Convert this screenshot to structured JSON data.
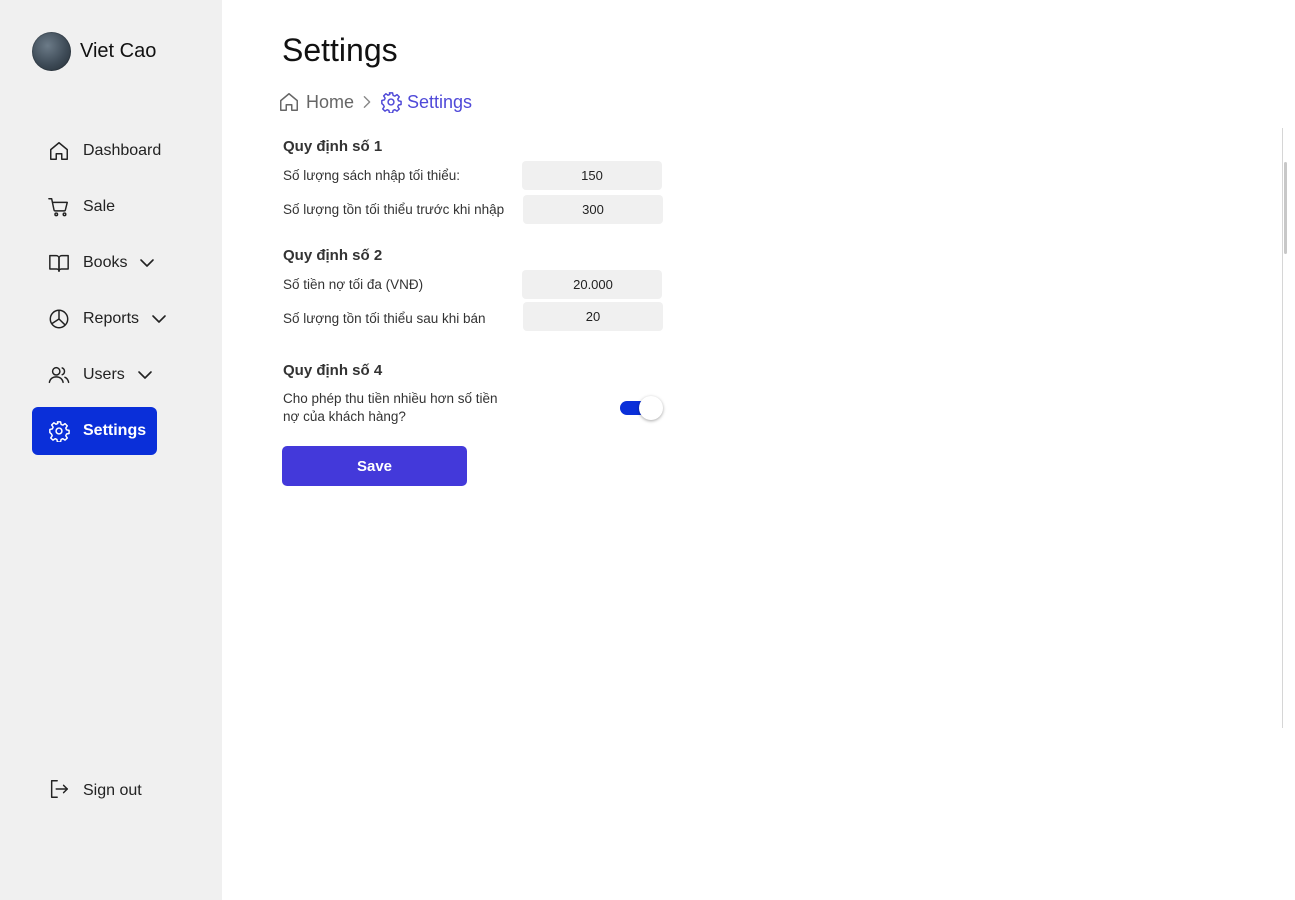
{
  "user": {
    "name": "Viet Cao"
  },
  "nav": {
    "items": [
      {
        "label": "Dashboard",
        "icon": "home-icon"
      },
      {
        "label": "Sale",
        "icon": "cart-icon"
      },
      {
        "label": "Books",
        "icon": "book-icon",
        "expandable": true
      },
      {
        "label": "Reports",
        "icon": "pie-chart-icon",
        "expandable": true
      },
      {
        "label": "Users",
        "icon": "users-icon",
        "expandable": true
      },
      {
        "label": "Settings",
        "icon": "gear-icon",
        "active": true
      }
    ],
    "signout_label": "Sign out"
  },
  "page": {
    "title": "Settings",
    "breadcrumb": {
      "home": "Home",
      "current": "Settings"
    }
  },
  "rules": {
    "rule1": {
      "title": "Quy định số 1",
      "min_import_label": "Số lượng sách nhập tối thiểu:",
      "min_import_value": "150",
      "max_stock_before_label": "Số lượng tồn tối thiểu trước khi nhập",
      "max_stock_before_value": "300"
    },
    "rule2": {
      "title": "Quy định số 2",
      "max_debt_label": "Số tiền nợ tối đa (VNĐ)",
      "max_debt_value": "20.000",
      "min_stock_after_label": "Số lượng tồn tối thiểu sau khi bán",
      "min_stock_after_value": "20"
    },
    "rule4": {
      "title": "Quy định số 4",
      "allow_overpay_label": "Cho phép thu tiền nhiều hơn số tiền nợ của khách hàng?",
      "allow_overpay_enabled": true
    }
  },
  "actions": {
    "save_label": "Save"
  },
  "colors": {
    "accent": "#0a2fd9",
    "button": "#4339da",
    "breadcrumb_active": "#4f49d8",
    "sidebar_bg": "#f0f0f0"
  }
}
